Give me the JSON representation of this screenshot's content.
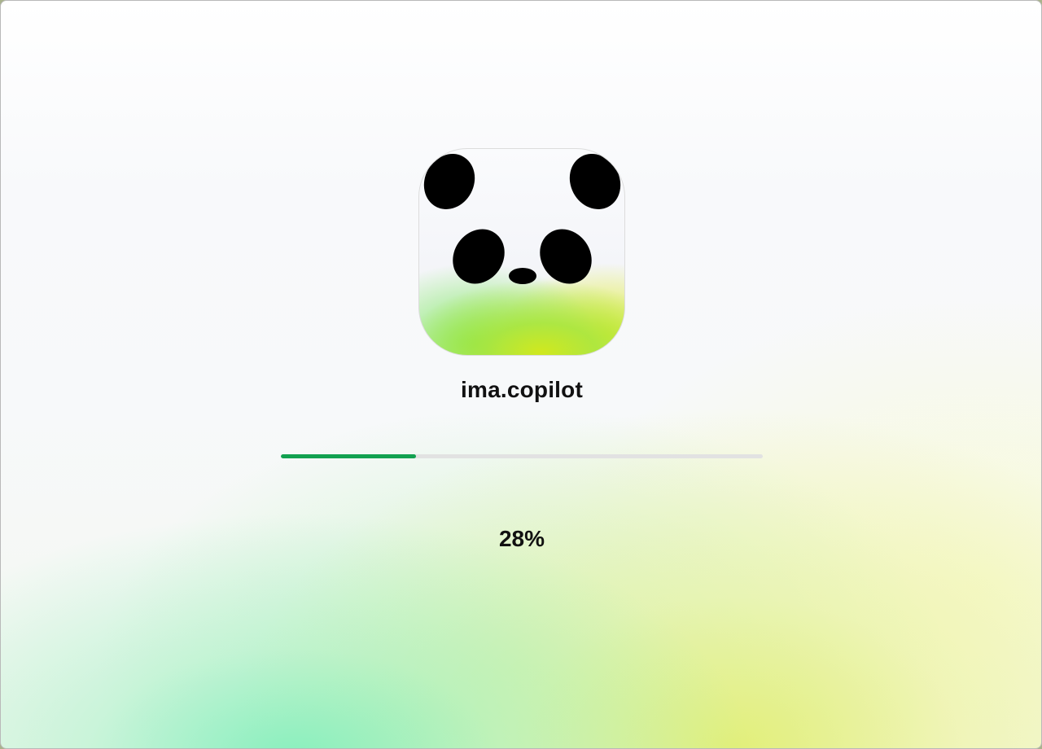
{
  "app": {
    "name": "ima.copilot",
    "icon": "panda-logo-icon"
  },
  "progress": {
    "percent_text": "28%",
    "fraction": 0.28,
    "fill_color": "#12a150",
    "track_color": "#e2e2e2"
  }
}
